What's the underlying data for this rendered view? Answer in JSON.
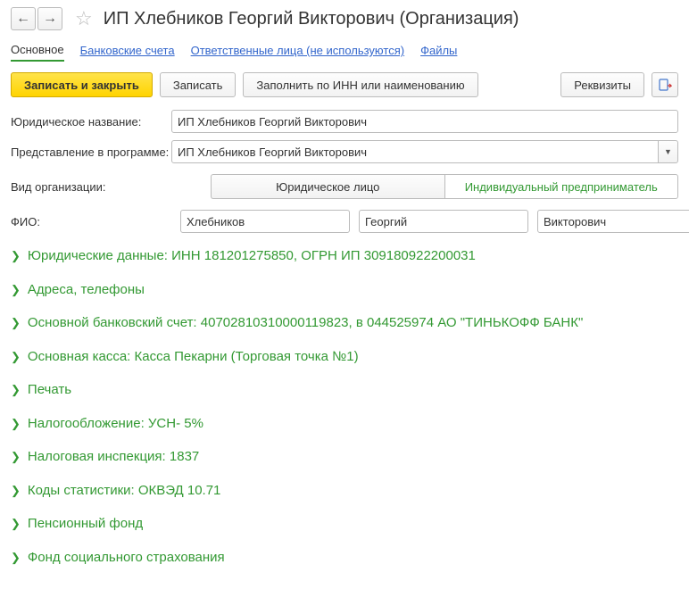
{
  "header": {
    "title": "ИП Хлебников Георгий Викторович (Организация)"
  },
  "tabs": {
    "main": "Основное",
    "bank": "Банковские счета",
    "resp": "Ответственные лица (не используются)",
    "files": "Файлы"
  },
  "toolbar": {
    "save_close": "Записать и закрыть",
    "save": "Записать",
    "fill_inn": "Заполнить по ИНН или наименованию",
    "requisites": "Реквизиты"
  },
  "form": {
    "legal_name_label": "Юридическое название:",
    "legal_name_value": "ИП Хлебников Георгий Викторович",
    "repr_label": "Представление в программе:",
    "repr_value": "ИП Хлебников Георгий Викторович",
    "org_type_label": "Вид организации:",
    "org_type_legal": "Юридическое лицо",
    "org_type_ie": "Индивидуальный предприниматель",
    "fio_label": "ФИО:",
    "last_name": "Хлебников",
    "first_name": "Георгий",
    "middle_name": "Викторович"
  },
  "sections": [
    "Юридические данные: ИНН 181201275850, ОГРН ИП 309180922200031",
    "Адреса, телефоны",
    "Основной банковский счет: 40702810310000119823, в 044525974 АО \"ТИНЬКОФФ БАНК\"",
    "Основная касса: Касса Пекарни (Торговая точка №1)",
    "Печать",
    "Налогообложение: УСН- 5%",
    "Налоговая инспекция: 1837",
    "Коды статистики: ОКВЭД 10.71",
    "Пенсионный фонд",
    "Фонд социального страхования"
  ]
}
